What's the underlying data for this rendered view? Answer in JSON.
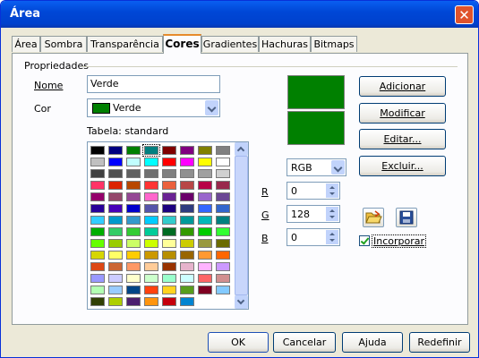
{
  "window": {
    "title": "Área",
    "close_glyph": "✕"
  },
  "tabs": [
    {
      "label": "Área",
      "active": false
    },
    {
      "label": "Sombra",
      "active": false
    },
    {
      "label": "Transparência",
      "active": false
    },
    {
      "label": "Cores",
      "active": true
    },
    {
      "label": "Gradientes",
      "active": false
    },
    {
      "label": "Hachuras",
      "active": false
    },
    {
      "label": "Bitmaps",
      "active": false
    }
  ],
  "properties": {
    "group_label": "Propriedades",
    "name_label": "Nome",
    "name_value": "Verde",
    "color_label": "Cor",
    "color_value": "Verde",
    "color_swatch": "#008000",
    "table_label": "Tabela: standard"
  },
  "palette": {
    "selected_index": 3,
    "colors": [
      "#000000",
      "#000080",
      "#008000",
      "#008080",
      "#800000",
      "#800080",
      "#808000",
      "#808080",
      "#c0c0c0",
      "#0000ff",
      "#c0ffff",
      "#00ffff",
      "#ff0000",
      "#ff00ff",
      "#ffff00",
      "#ffffff",
      "#404040",
      "#505050",
      "#606060",
      "#707070",
      "#808080",
      "#909090",
      "#a0a0a0",
      "#d0d0d0",
      "#ff3366",
      "#dc2300",
      "#b84700",
      "#ff3333",
      "#eb613d",
      "#b84747",
      "#b80047",
      "#99284c",
      "#94006b",
      "#94476b",
      "#944794",
      "#ff66cc",
      "#6b2394",
      "#6b006b",
      "#9966cc",
      "#6b4794",
      "#280099",
      "#4700b8",
      "#0000cc",
      "#5555aa",
      "#1c007f",
      "#2e3b7f",
      "#3366ff",
      "#3366cc",
      "#33ccff",
      "#0099cc",
      "#3399cc",
      "#00ccff",
      "#33cccc",
      "#009999",
      "#00b8b8",
      "#008080",
      "#00ae00",
      "#33cc66",
      "#33cc33",
      "#00cc99",
      "#006b23",
      "#339900",
      "#00cc00",
      "#33ff33",
      "#66ff00",
      "#99cc00",
      "#ccff66",
      "#ccff00",
      "#ffff99",
      "#cccc00",
      "#99993f",
      "#6b6b00",
      "#d6d600",
      "#ffff66",
      "#ffcc00",
      "#cc9900",
      "#b88f00",
      "#996600",
      "#ff9933",
      "#ff6600",
      "#dd4814",
      "#cc6633",
      "#ff9966",
      "#ffcc99",
      "#993300",
      "#e6b3cc",
      "#ffb3ff",
      "#cc99ff",
      "#9999ff",
      "#ccccff",
      "#ffffcc",
      "#ccffcc",
      "#99ffcc",
      "#ccffff",
      "#ff6666",
      "#d18f8f",
      "#b3ffb3",
      "#99ccff",
      "#004586",
      "#ff420e",
      "#ffd320",
      "#579d1c",
      "#7e0021",
      "#83caff",
      "#314004",
      "#aecf00",
      "#4b1f6f",
      "#ff950e",
      "#c5000b",
      "#0084d1"
    ]
  },
  "preview": {
    "top_color": "#008000",
    "bottom_color": "#008000"
  },
  "buttons": {
    "add": "Adicionar",
    "modify": "Modificar",
    "edit": "Editar...",
    "delete": "Excluir..."
  },
  "color_model": {
    "value": "RGB"
  },
  "rgb": {
    "r_label": "R",
    "r_value": "0",
    "g_label": "G",
    "g_value": "128",
    "b_label": "B",
    "b_value": "0"
  },
  "embed": {
    "label": "Incorporar",
    "checked": true
  },
  "icons": {
    "load": "folder-open-icon",
    "save": "save-disk-icon"
  },
  "footer": {
    "ok": "OK",
    "cancel": "Cancelar",
    "help": "Ajuda",
    "reset": "Redefinir"
  }
}
